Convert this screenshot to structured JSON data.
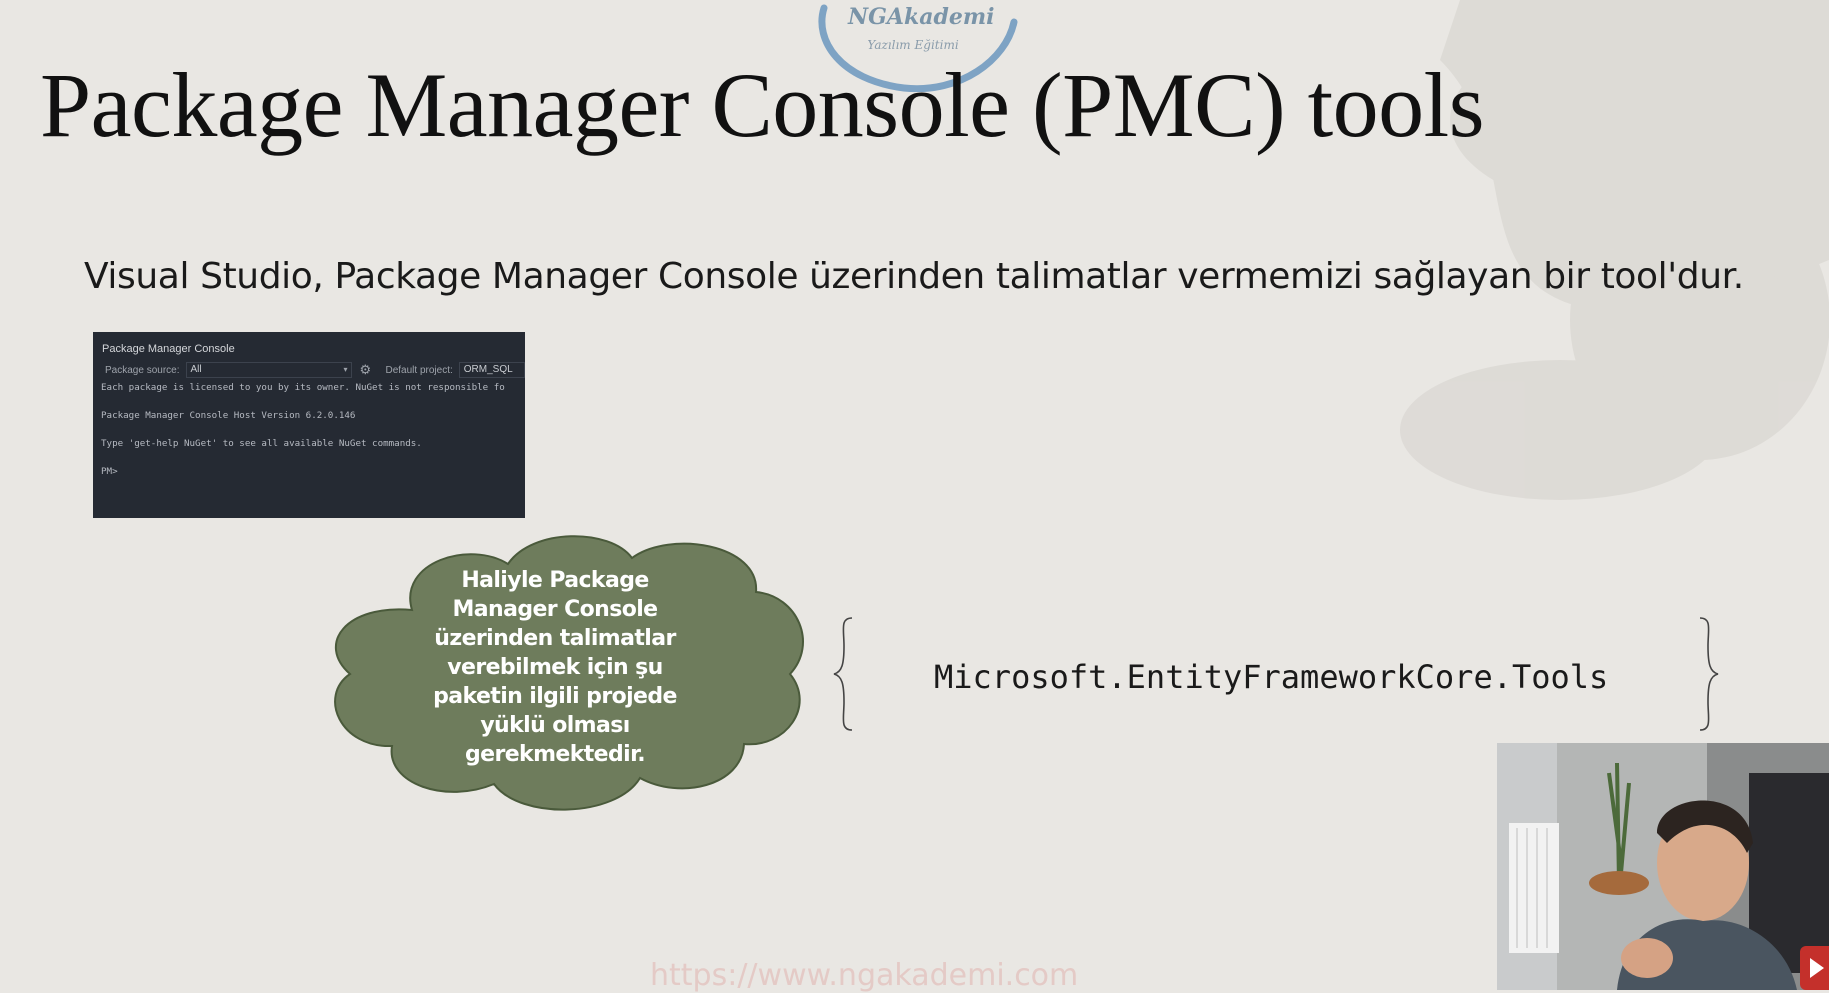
{
  "logo": {
    "line1": "NGAkademi",
    "line2": "Yazılım Eğitimi"
  },
  "slide": {
    "title": "Package Manager Console (PMC) tools",
    "subtitle": "Visual Studio, Package Manager Console üzerinden talimatlar vermemizi sağlayan bir tool'dur."
  },
  "pmc_window": {
    "title": "Package Manager Console",
    "package_source_label": "Package source:",
    "package_source_value": "All",
    "default_project_label": "Default project:",
    "default_project_value": "ORM_SQL",
    "lines": [
      "Each package is licensed to you by its owner. NuGet is not responsible fo",
      "",
      "Package Manager Console Host Version 6.2.0.146",
      "",
      "Type 'get-help NuGet' to see all available NuGet commands.",
      "",
      "PM>"
    ]
  },
  "cloud": {
    "lines": [
      "Haliyle Package",
      "Manager Console",
      "üzerinden talimatlar",
      "verebilmek için şu",
      "paketin ilgili projede",
      "yüklü olması",
      "gerekmektedir."
    ]
  },
  "package": {
    "name": "Microsoft.EntityFrameworkCore.Tools"
  },
  "watermark": {
    "text": "https://www.ngakademi.com"
  },
  "colors": {
    "background": "#e9e7e3",
    "cloud_fill": "#6e7c5c",
    "console_bg": "#252a33",
    "logo_blue": "#7a94a8"
  }
}
